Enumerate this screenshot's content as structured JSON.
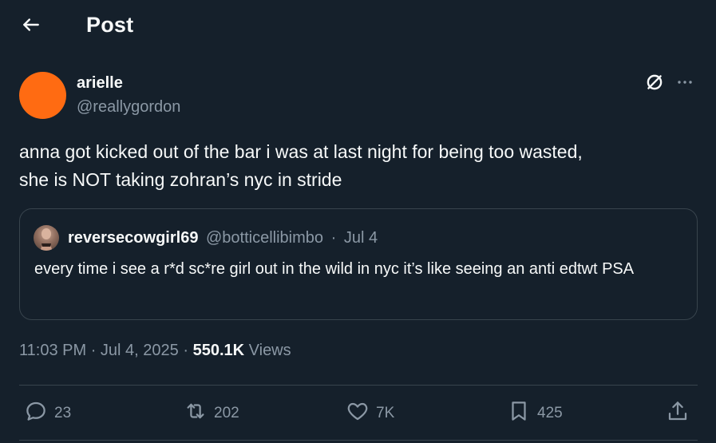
{
  "header": {
    "title": "Post",
    "back_icon": "arrow-left-icon"
  },
  "post": {
    "author": {
      "display_name": "arielle",
      "handle": "@reallygordon",
      "avatar_color": "#ff6b12"
    },
    "text": "anna got kicked out of the bar i was at last night for being too wasted,\nshe is NOT taking zohran’s nyc in stride",
    "quote": {
      "display_name": "reversecowgirl69",
      "handle": "@botticellibimbo",
      "separator": "·",
      "date": "Jul 4",
      "text": "every time i see a r*d sc*re girl out in the wild in nyc it’s like seeing an anti edtwt PSA"
    },
    "meta": {
      "time": "11:03 PM",
      "separator": "·",
      "date": "Jul 4, 2025",
      "separator2": "·",
      "views_count": "550.1K",
      "views_label": "Views"
    },
    "actions": {
      "replies": "23",
      "reposts": "202",
      "likes": "7K",
      "bookmarks": "425"
    }
  },
  "colors": {
    "background": "#15202b",
    "text_primary": "#f7f9f9",
    "text_secondary": "#8b98a5",
    "border": "#38444d"
  }
}
